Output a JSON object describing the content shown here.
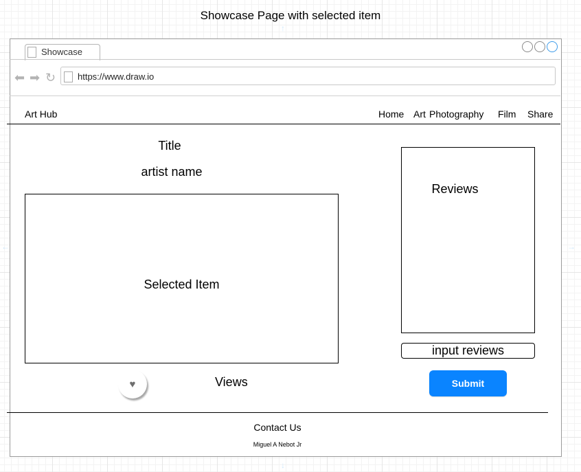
{
  "page_title": "Showcase Page with selected item",
  "browser": {
    "tab_label": "Showcase",
    "url": "https://www.draw.io",
    "window_controls": [
      "circle-icon",
      "circle-icon",
      "circle-icon"
    ],
    "nav_icons": [
      "back-arrow-icon",
      "forward-arrow-icon",
      "refresh-icon"
    ]
  },
  "header": {
    "brand": "Art Hub",
    "nav": [
      "Home",
      "Art",
      "Photography",
      "Film",
      "Share"
    ]
  },
  "showcase": {
    "title": "Title",
    "artist": "artist name",
    "item_label": "Selected Item",
    "like_icon": "heart-icon",
    "views_label": "Views"
  },
  "reviews": {
    "label": "Reviews",
    "input_value": "input reviews",
    "submit_label": "Submit"
  },
  "footer": {
    "contact": "Contact Us",
    "credit": "Miguel A Nebot Jr"
  },
  "colors": {
    "accent": "#0a84ff",
    "grid": "#e6e6e6"
  }
}
